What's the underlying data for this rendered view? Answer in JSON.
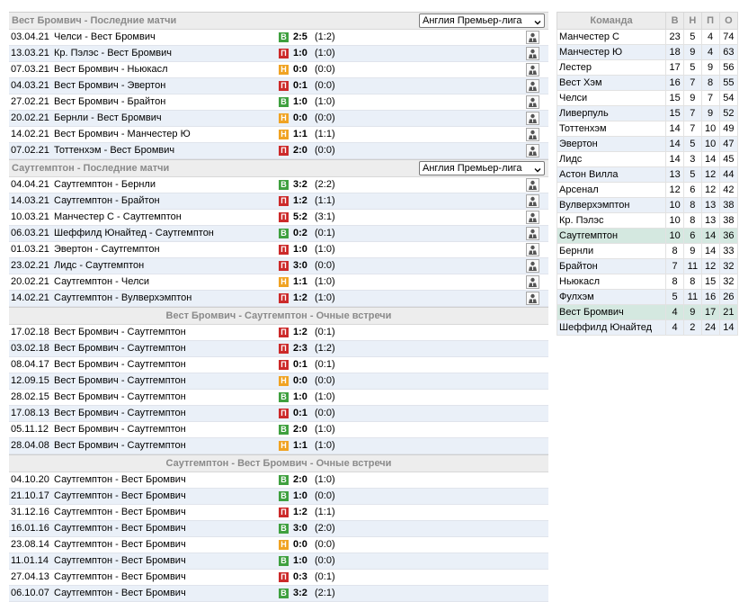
{
  "sections": [
    {
      "title": "Вест Бромвич - Последние матчи",
      "select": "Англия Премьер-лига",
      "align": "left",
      "refs": true,
      "rows": [
        {
          "date": "03.04.21",
          "teams": "Челси - Вест Бромвич",
          "r": "В",
          "t": "w",
          "score": "2:5",
          "half": "(1:2)"
        },
        {
          "date": "13.03.21",
          "teams": "Кр. Пэлэс - Вест Бромвич",
          "r": "П",
          "t": "l",
          "score": "1:0",
          "half": "(1:0)"
        },
        {
          "date": "07.03.21",
          "teams": "Вест Бромвич - Ньюкасл",
          "r": "Н",
          "t": "d",
          "score": "0:0",
          "half": "(0:0)"
        },
        {
          "date": "04.03.21",
          "teams": "Вест Бромвич - Эвертон",
          "r": "П",
          "t": "l",
          "score": "0:1",
          "half": "(0:0)"
        },
        {
          "date": "27.02.21",
          "teams": "Вест Бромвич - Брайтон",
          "r": "В",
          "t": "w",
          "score": "1:0",
          "half": "(1:0)"
        },
        {
          "date": "20.02.21",
          "teams": "Бернли - Вест Бромвич",
          "r": "Н",
          "t": "d",
          "score": "0:0",
          "half": "(0:0)"
        },
        {
          "date": "14.02.21",
          "teams": "Вест Бромвич - Манчестер Ю",
          "r": "Н",
          "t": "d",
          "score": "1:1",
          "half": "(1:1)"
        },
        {
          "date": "07.02.21",
          "teams": "Тоттенхэм - Вест Бромвич",
          "r": "П",
          "t": "l",
          "score": "2:0",
          "half": "(0:0)"
        }
      ]
    },
    {
      "title": "Саутгемптон - Последние матчи",
      "select": "Англия Премьер-лига",
      "align": "left",
      "refs": true,
      "rows": [
        {
          "date": "04.04.21",
          "teams": "Саутгемптон - Бернли",
          "r": "В",
          "t": "w",
          "score": "3:2",
          "half": "(2:2)"
        },
        {
          "date": "14.03.21",
          "teams": "Саутгемптон - Брайтон",
          "r": "П",
          "t": "l",
          "score": "1:2",
          "half": "(1:1)"
        },
        {
          "date": "10.03.21",
          "teams": "Манчестер С - Саутгемптон",
          "r": "П",
          "t": "l",
          "score": "5:2",
          "half": "(3:1)"
        },
        {
          "date": "06.03.21",
          "teams": "Шеффилд Юнайтед - Саутгемптон",
          "r": "В",
          "t": "w",
          "score": "0:2",
          "half": "(0:1)"
        },
        {
          "date": "01.03.21",
          "teams": "Эвертон - Саутгемптон",
          "r": "П",
          "t": "l",
          "score": "1:0",
          "half": "(1:0)"
        },
        {
          "date": "23.02.21",
          "teams": "Лидс - Саутгемптон",
          "r": "П",
          "t": "l",
          "score": "3:0",
          "half": "(0:0)"
        },
        {
          "date": "20.02.21",
          "teams": "Саутгемптон - Челси",
          "r": "Н",
          "t": "d",
          "score": "1:1",
          "half": "(1:0)"
        },
        {
          "date": "14.02.21",
          "teams": "Саутгемптон - Вулверхэмптон",
          "r": "П",
          "t": "l",
          "score": "1:2",
          "half": "(1:0)"
        }
      ]
    },
    {
      "title": "Вест Бромвич - Саутгемптон - Очные встречи",
      "select": "",
      "align": "center",
      "refs": false,
      "rows": [
        {
          "date": "17.02.18",
          "teams": "Вест Бромвич - Саутгемптон",
          "r": "П",
          "t": "l",
          "score": "1:2",
          "half": "(0:1)"
        },
        {
          "date": "03.02.18",
          "teams": "Вест Бромвич - Саутгемптон",
          "r": "П",
          "t": "l",
          "score": "2:3",
          "half": "(1:2)"
        },
        {
          "date": "08.04.17",
          "teams": "Вест Бромвич - Саутгемптон",
          "r": "П",
          "t": "l",
          "score": "0:1",
          "half": "(0:1)"
        },
        {
          "date": "12.09.15",
          "teams": "Вест Бромвич - Саутгемптон",
          "r": "Н",
          "t": "d",
          "score": "0:0",
          "half": "(0:0)"
        },
        {
          "date": "28.02.15",
          "teams": "Вест Бромвич - Саутгемптон",
          "r": "В",
          "t": "w",
          "score": "1:0",
          "half": "(1:0)"
        },
        {
          "date": "17.08.13",
          "teams": "Вест Бромвич - Саутгемптон",
          "r": "П",
          "t": "l",
          "score": "0:1",
          "half": "(0:0)"
        },
        {
          "date": "05.11.12",
          "teams": "Вест Бромвич - Саутгемптон",
          "r": "В",
          "t": "w",
          "score": "2:0",
          "half": "(1:0)"
        },
        {
          "date": "28.04.08",
          "teams": "Вест Бромвич - Саутгемптон",
          "r": "Н",
          "t": "d",
          "score": "1:1",
          "half": "(1:0)"
        }
      ]
    },
    {
      "title": "Саутгемптон - Вест Бромвич - Очные встречи",
      "select": "",
      "align": "center",
      "refs": false,
      "rows": [
        {
          "date": "04.10.20",
          "teams": "Саутгемптон - Вест Бромвич",
          "r": "В",
          "t": "w",
          "score": "2:0",
          "half": "(1:0)"
        },
        {
          "date": "21.10.17",
          "teams": "Саутгемптон - Вест Бромвич",
          "r": "В",
          "t": "w",
          "score": "1:0",
          "half": "(0:0)"
        },
        {
          "date": "31.12.16",
          "teams": "Саутгемптон - Вест Бромвич",
          "r": "П",
          "t": "l",
          "score": "1:2",
          "half": "(1:1)"
        },
        {
          "date": "16.01.16",
          "teams": "Саутгемптон - Вест Бромвич",
          "r": "В",
          "t": "w",
          "score": "3:0",
          "half": "(2:0)"
        },
        {
          "date": "23.08.14",
          "teams": "Саутгемптон - Вест Бромвич",
          "r": "Н",
          "t": "d",
          "score": "0:0",
          "half": "(0:0)"
        },
        {
          "date": "11.01.14",
          "teams": "Саутгемптон - Вест Бромвич",
          "r": "В",
          "t": "w",
          "score": "1:0",
          "half": "(0:0)"
        },
        {
          "date": "27.04.13",
          "teams": "Саутгемптон - Вест Бромвич",
          "r": "П",
          "t": "l",
          "score": "0:3",
          "half": "(0:1)"
        },
        {
          "date": "06.10.07",
          "teams": "Саутгемптон - Вест Бромвич",
          "r": "В",
          "t": "w",
          "score": "3:2",
          "half": "(2:1)"
        }
      ]
    }
  ],
  "standings": {
    "headers": [
      "Команда",
      "В",
      "Н",
      "П",
      "О"
    ],
    "rows": [
      {
        "team": "Манчестер С",
        "w": "23",
        "d": "5",
        "l": "4",
        "p": "74"
      },
      {
        "team": "Манчестер Ю",
        "w": "18",
        "d": "9",
        "l": "4",
        "p": "63"
      },
      {
        "team": "Лестер",
        "w": "17",
        "d": "5",
        "l": "9",
        "p": "56"
      },
      {
        "team": "Вест Хэм",
        "w": "16",
        "d": "7",
        "l": "8",
        "p": "55"
      },
      {
        "team": "Челси",
        "w": "15",
        "d": "9",
        "l": "7",
        "p": "54"
      },
      {
        "team": "Ливерпуль",
        "w": "15",
        "d": "7",
        "l": "9",
        "p": "52"
      },
      {
        "team": "Тоттенхэм",
        "w": "14",
        "d": "7",
        "l": "10",
        "p": "49"
      },
      {
        "team": "Эвертон",
        "w": "14",
        "d": "5",
        "l": "10",
        "p": "47"
      },
      {
        "team": "Лидс",
        "w": "14",
        "d": "3",
        "l": "14",
        "p": "45"
      },
      {
        "team": "Астон Вилла",
        "w": "13",
        "d": "5",
        "l": "12",
        "p": "44"
      },
      {
        "team": "Арсенал",
        "w": "12",
        "d": "6",
        "l": "12",
        "p": "42"
      },
      {
        "team": "Вулверхэмптон",
        "w": "10",
        "d": "8",
        "l": "13",
        "p": "38"
      },
      {
        "team": "Кр. Пэлэс",
        "w": "10",
        "d": "8",
        "l": "13",
        "p": "38"
      },
      {
        "team": "Саутгемптон",
        "w": "10",
        "d": "6",
        "l": "14",
        "p": "36",
        "hl": true
      },
      {
        "team": "Бернли",
        "w": "8",
        "d": "9",
        "l": "14",
        "p": "33"
      },
      {
        "team": "Брайтон",
        "w": "7",
        "d": "11",
        "l": "12",
        "p": "32"
      },
      {
        "team": "Ньюкасл",
        "w": "8",
        "d": "8",
        "l": "15",
        "p": "32"
      },
      {
        "team": "Фулхэм",
        "w": "5",
        "d": "11",
        "l": "16",
        "p": "26"
      },
      {
        "team": "Вест Бромвич",
        "w": "4",
        "d": "9",
        "l": "17",
        "p": "21",
        "hl": true
      },
      {
        "team": "Шеффилд Юнайтед",
        "w": "4",
        "d": "2",
        "l": "24",
        "p": "14"
      }
    ]
  },
  "colors": {
    "win": "#3fa03f",
    "loss": "#cc2a2a",
    "draw": "#f0a323",
    "alt_row": "#eaf0f8",
    "highlight_row": "#d4e8e0"
  }
}
